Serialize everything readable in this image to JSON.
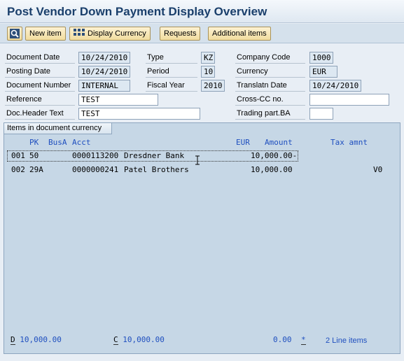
{
  "title": "Post Vendor Down Payment Display Overview",
  "toolbar": {
    "buttons": [
      "New item",
      "Display Currency",
      "Requests",
      "Additional items"
    ]
  },
  "header": {
    "document_date": {
      "label": "Document Date",
      "value": "10/24/2010"
    },
    "posting_date": {
      "label": "Posting Date",
      "value": "10/24/2010"
    },
    "document_number": {
      "label": "Document Number",
      "value": "INTERNAL"
    },
    "reference": {
      "label": "Reference",
      "value": "TEST"
    },
    "doc_header_text": {
      "label": "Doc.Header Text",
      "value": "TEST"
    },
    "type": {
      "label": "Type",
      "value": "KZ"
    },
    "period": {
      "label": "Period",
      "value": "10"
    },
    "fiscal_year": {
      "label": "Fiscal Year",
      "value": "2010"
    },
    "company_code": {
      "label": "Company Code",
      "value": "1000"
    },
    "currency": {
      "label": "Currency",
      "value": "EUR"
    },
    "translatn_date": {
      "label": "Translatn Date",
      "value": "10/24/2010"
    },
    "cross_cc_no": {
      "label": "Cross-CC no.",
      "value": ""
    },
    "trading_part_ba": {
      "label": "Trading part.BA",
      "value": ""
    }
  },
  "items": {
    "tab_label": "Items in document currency",
    "columns": {
      "pk": "PK",
      "busa": "BusA",
      "acct": "Acct",
      "cur": "EUR",
      "amount": "Amount",
      "tax": "Tax amnt"
    },
    "rows": [
      {
        "line": "001",
        "pk": "50",
        "busa": "",
        "acct": "0000113200",
        "name": "Dresdner Bank",
        "amount": "10,000.00-",
        "tax": ""
      },
      {
        "line": "002",
        "pk": "29A",
        "busa": "",
        "acct": "0000000241",
        "name": "Patel Brothers",
        "amount": "10,000.00",
        "tax": "V0"
      }
    ]
  },
  "footer": {
    "debit_label": "D",
    "debit_value": "10,000.00",
    "credit_label": "C",
    "credit_value": "10,000.00",
    "balance": "0.00",
    "status": "*",
    "line_items": "2 Line items"
  }
}
